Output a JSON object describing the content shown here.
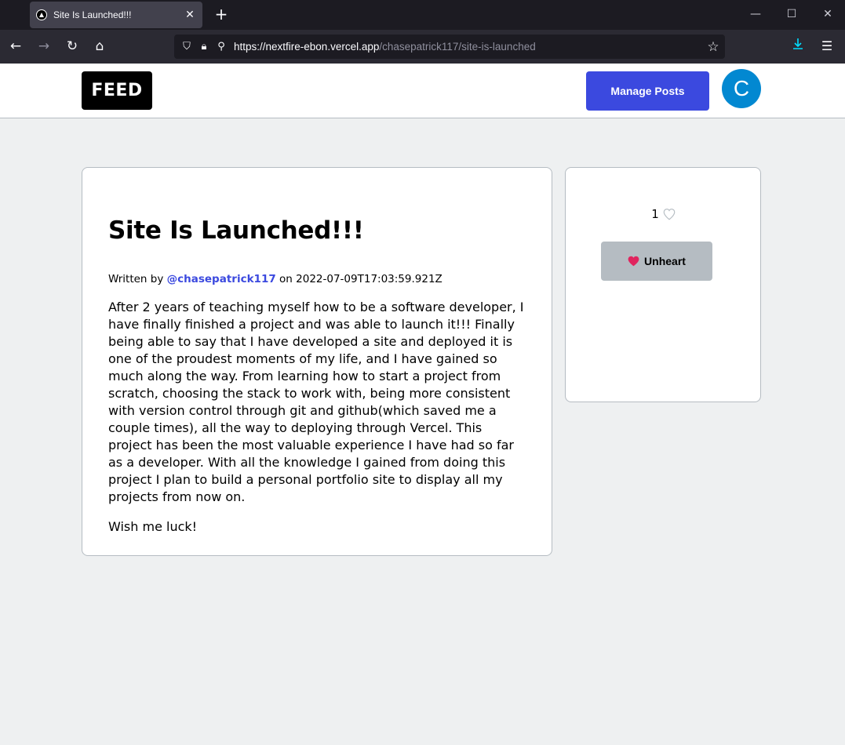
{
  "browser": {
    "tab_title": "Site Is Launched!!!",
    "url_host": "https://nextfire-ebon.vercel.app",
    "url_path": "/chasepatrick117/site-is-launched"
  },
  "header": {
    "logo": "FEED",
    "manage_button": "Manage Posts",
    "avatar_letter": "C"
  },
  "post": {
    "title": "Site Is Launched!!!",
    "written_by": "Written by",
    "author": "@chasepatrick117",
    "on": "on",
    "date": "2022-07-09T17:03:59.921Z",
    "paragraphs": [
      "After 2 years of teaching myself how to be a software developer, I have finally finished a project and was able to launch it!!! Finally being able to say that I have developed a site and deployed it is one of the proudest moments of my life, and I have gained so much along the way. From learning how to start a project from scratch, choosing the stack to work with, being more consistent with version control through git and github(which saved me a couple times), all the way to deploying through Vercel. This project has been the most valuable experience I have had so far as a developer. With all the knowledge I gained from doing this project I plan to build a personal portfolio site to display all my projects from now on.",
      "Wish me luck!"
    ]
  },
  "aside": {
    "heart_count": "1",
    "unheart_label": "Unheart"
  },
  "colors": {
    "accent": "#3b49df",
    "avatar": "#0288d1",
    "heart": "#e0245e"
  }
}
